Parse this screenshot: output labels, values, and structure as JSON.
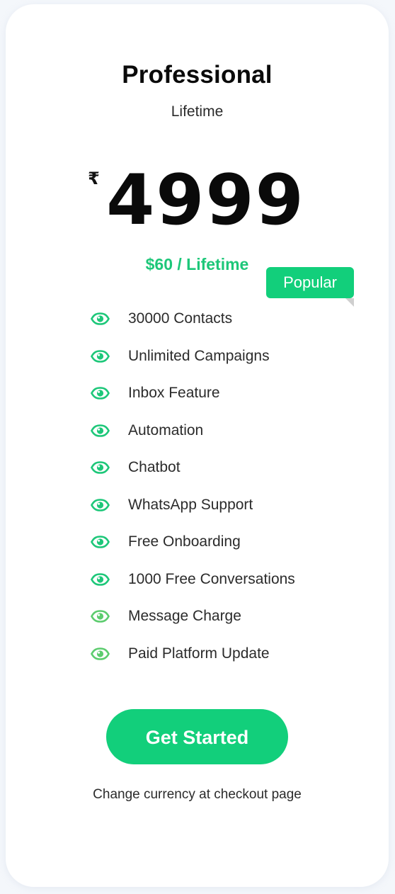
{
  "plan": {
    "name": "Professional",
    "period": "Lifetime",
    "currency_symbol": "₹",
    "price": "4999",
    "usd_price": "$60 / Lifetime",
    "badge": "Popular"
  },
  "features": [
    {
      "label": "30000 Contacts",
      "icon": "eye-icon",
      "color": "#1dc779"
    },
    {
      "label": "Unlimited Campaigns",
      "icon": "eye-icon",
      "color": "#1dc779"
    },
    {
      "label": "Inbox Feature",
      "icon": "eye-icon",
      "color": "#1dc779"
    },
    {
      "label": "Automation",
      "icon": "eye-icon",
      "color": "#1dc779"
    },
    {
      "label": "Chatbot",
      "icon": "eye-icon",
      "color": "#1dc779"
    },
    {
      "label": "WhatsApp Support",
      "icon": "eye-icon",
      "color": "#1dc779"
    },
    {
      "label": "Free Onboarding",
      "icon": "eye-icon",
      "color": "#1dc779"
    },
    {
      "label": "1000 Free Conversations",
      "icon": "eye-icon",
      "color": "#1dc779"
    },
    {
      "label": "Message Charge",
      "icon": "eye-icon",
      "color": "#5ccc6e"
    },
    {
      "label": "Paid Platform Update",
      "icon": "eye-icon",
      "color": "#5ccc6e"
    }
  ],
  "cta": {
    "label": "Get Started"
  },
  "note": "Change currency at checkout page",
  "colors": {
    "accent": "#12cf7b",
    "price_green": "#1dc779",
    "muted_green": "#5ccc6e",
    "background": "#f4f7fb",
    "card": "#ffffff"
  }
}
